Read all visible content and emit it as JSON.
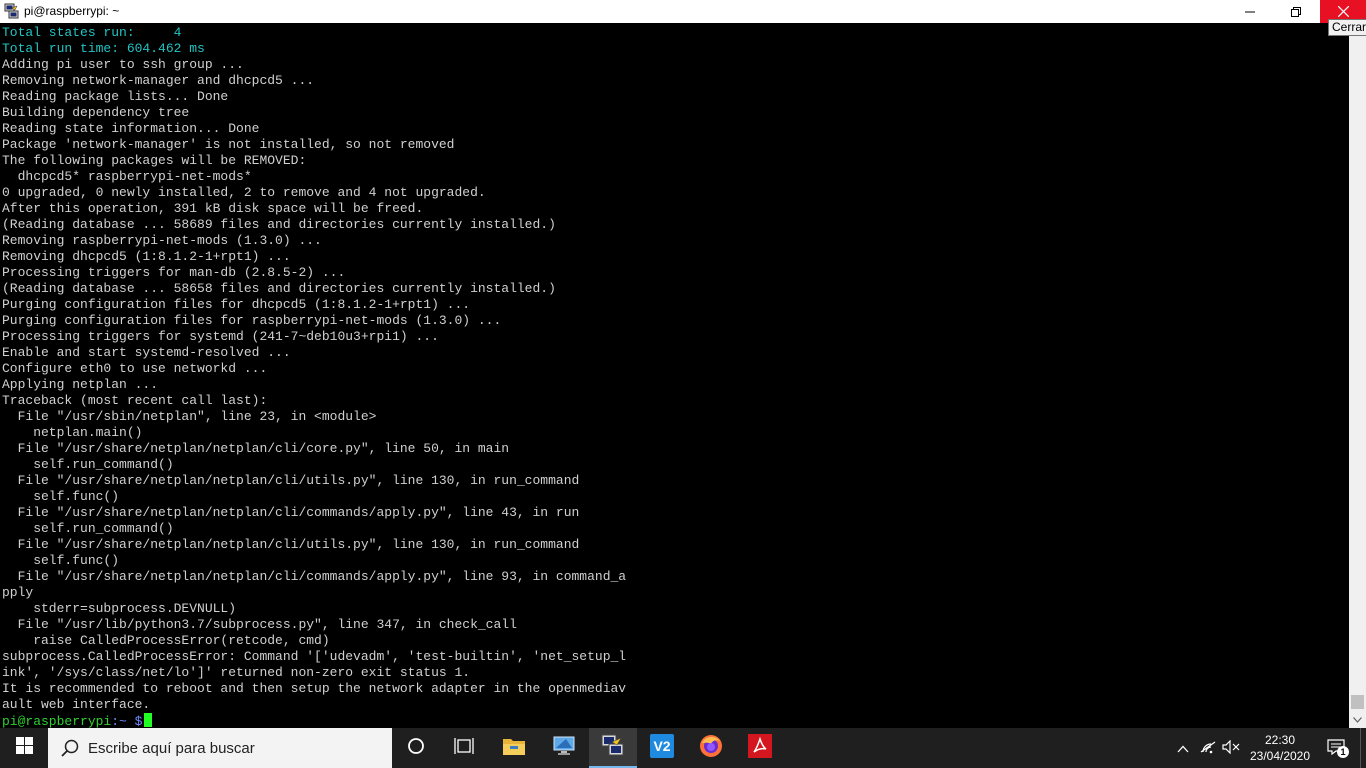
{
  "window": {
    "title": "pi@raspberrypi: ~",
    "close_tooltip": "Cerrar"
  },
  "terminal": {
    "lines": [
      {
        "text": "Total states run:     4",
        "color": "cyan"
      },
      {
        "text": "Total run time: 604.462 ms",
        "color": "cyan"
      },
      {
        "text": "Adding pi user to ssh group ..."
      },
      {
        "text": "Removing network-manager and dhcpcd5 ..."
      },
      {
        "text": "Reading package lists... Done"
      },
      {
        "text": "Building dependency tree"
      },
      {
        "text": "Reading state information... Done"
      },
      {
        "text": "Package 'network-manager' is not installed, so not removed"
      },
      {
        "text": "The following packages will be REMOVED:"
      },
      {
        "text": "  dhcpcd5* raspberrypi-net-mods*"
      },
      {
        "text": "0 upgraded, 0 newly installed, 2 to remove and 4 not upgraded."
      },
      {
        "text": "After this operation, 391 kB disk space will be freed."
      },
      {
        "text": "(Reading database ... 58689 files and directories currently installed.)"
      },
      {
        "text": "Removing raspberrypi-net-mods (1.3.0) ..."
      },
      {
        "text": "Removing dhcpcd5 (1:8.1.2-1+rpt1) ..."
      },
      {
        "text": "Processing triggers for man-db (2.8.5-2) ..."
      },
      {
        "text": "(Reading database ... 58658 files and directories currently installed.)"
      },
      {
        "text": "Purging configuration files for dhcpcd5 (1:8.1.2-1+rpt1) ..."
      },
      {
        "text": "Purging configuration files for raspberrypi-net-mods (1.3.0) ..."
      },
      {
        "text": "Processing triggers for systemd (241-7~deb10u3+rpi1) ..."
      },
      {
        "text": "Enable and start systemd-resolved ..."
      },
      {
        "text": "Configure eth0 to use networkd ..."
      },
      {
        "text": "Applying netplan ..."
      },
      {
        "text": "Traceback (most recent call last):"
      },
      {
        "text": "  File \"/usr/sbin/netplan\", line 23, in <module>"
      },
      {
        "text": "    netplan.main()"
      },
      {
        "text": "  File \"/usr/share/netplan/netplan/cli/core.py\", line 50, in main"
      },
      {
        "text": "    self.run_command()"
      },
      {
        "text": "  File \"/usr/share/netplan/netplan/cli/utils.py\", line 130, in run_command"
      },
      {
        "text": "    self.func()"
      },
      {
        "text": "  File \"/usr/share/netplan/netplan/cli/commands/apply.py\", line 43, in run"
      },
      {
        "text": "    self.run_command()"
      },
      {
        "text": "  File \"/usr/share/netplan/netplan/cli/utils.py\", line 130, in run_command"
      },
      {
        "text": "    self.func()"
      },
      {
        "text": "  File \"/usr/share/netplan/netplan/cli/commands/apply.py\", line 93, in command_a"
      },
      {
        "text": "pply"
      },
      {
        "text": "    stderr=subprocess.DEVNULL)"
      },
      {
        "text": "  File \"/usr/lib/python3.7/subprocess.py\", line 347, in check_call"
      },
      {
        "text": "    raise CalledProcessError(retcode, cmd)"
      },
      {
        "text": "subprocess.CalledProcessError: Command '['udevadm', 'test-builtin', 'net_setup_l"
      },
      {
        "text": "ink', '/sys/class/net/lo']' returned non-zero exit status 1."
      },
      {
        "text": "It is recommended to reboot and then setup the network adapter in the openmediav"
      },
      {
        "text": "ault web interface."
      }
    ],
    "prompt": {
      "user_host": "pi@raspberrypi",
      "path": ":~",
      "symbol": " $"
    }
  },
  "taskbar": {
    "search_placeholder": "Escribe aquí para buscar",
    "apps": [
      {
        "name": "cortana",
        "icon": "circle-icon"
      },
      {
        "name": "task-view",
        "icon": "task-view-icon"
      },
      {
        "name": "file-explorer",
        "icon": "folder-icon"
      },
      {
        "name": "remote-desktop",
        "icon": "remote-desktop-icon"
      },
      {
        "name": "putty",
        "icon": "putty-icon",
        "active": true
      },
      {
        "name": "vnc-viewer",
        "icon": "vnc-icon",
        "label": "V2"
      },
      {
        "name": "firefox",
        "icon": "firefox-icon"
      },
      {
        "name": "acrobat",
        "icon": "acrobat-icon"
      }
    ],
    "time": "22:30",
    "date": "23/04/2020",
    "notification_count": "1"
  }
}
